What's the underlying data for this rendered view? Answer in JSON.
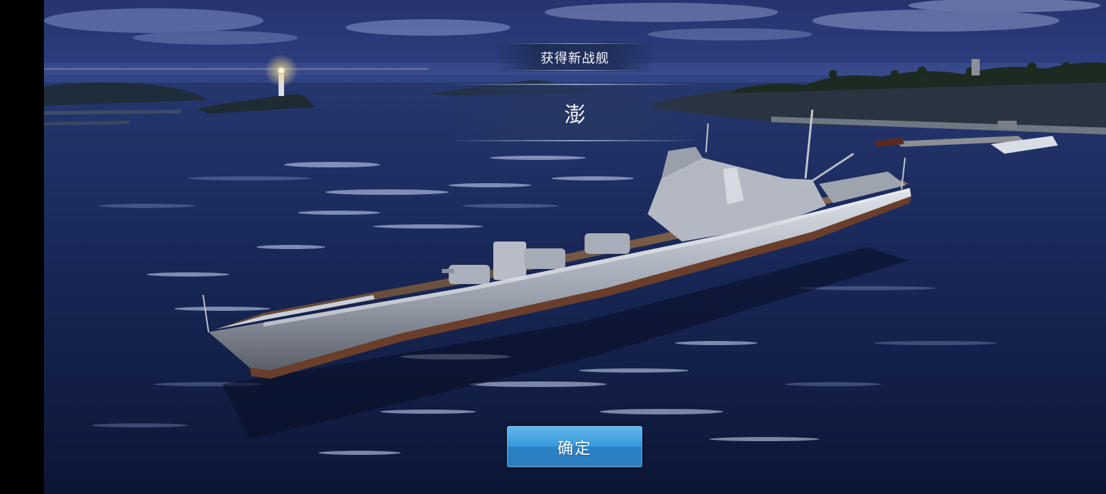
{
  "dialog": {
    "title": "获得新战舰",
    "ship_name": "澎"
  },
  "buttons": {
    "confirm_label": "确定"
  },
  "colors": {
    "sky_top": "#1e2a5e",
    "sea": "#0f1d45",
    "button_blue": "#3a98d9"
  }
}
